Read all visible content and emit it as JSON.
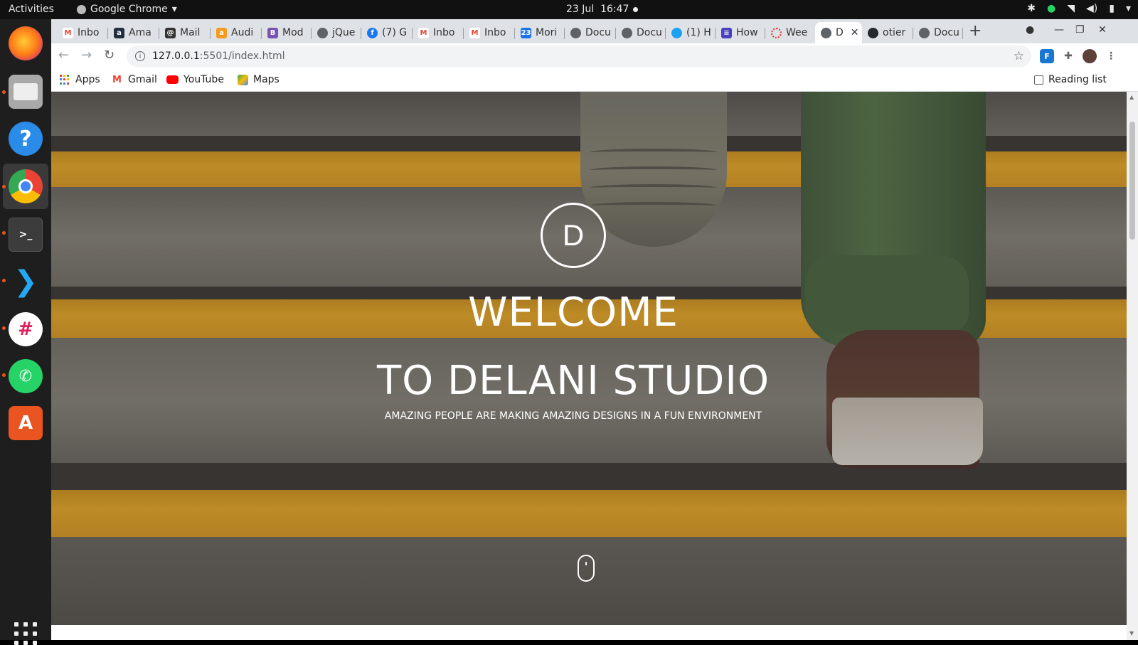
{
  "system_bar": {
    "activities": "Activities",
    "app_name": "Google Chrome",
    "date": "23 Jul",
    "time": "16:47"
  },
  "dock": {
    "apps": [
      "firefox-icon",
      "files-icon",
      "help-icon",
      "chrome-icon",
      "terminal-icon",
      "vscode-icon",
      "slack-icon",
      "whatsapp-icon",
      "software-center-icon"
    ]
  },
  "tabs": [
    {
      "label": "Inbo",
      "icon": "gmail-icon"
    },
    {
      "label": "Ama",
      "icon": "amazon-icon"
    },
    {
      "label": "Mail",
      "icon": "mailchimp-icon"
    },
    {
      "label": "Audi",
      "icon": "audible-icon"
    },
    {
      "label": "Mod",
      "icon": "bootstrap-icon"
    },
    {
      "label": "jQue",
      "icon": "globe-icon"
    },
    {
      "label": "(7) G",
      "icon": "facebook-icon"
    },
    {
      "label": "Inbo",
      "icon": "gmail-icon"
    },
    {
      "label": "Inbo",
      "icon": "gmail-icon"
    },
    {
      "label": "Mori",
      "icon": "calendar-icon"
    },
    {
      "label": "Docu",
      "icon": "globe-icon"
    },
    {
      "label": "Docu",
      "icon": "globe-icon"
    },
    {
      "label": "(1) H",
      "icon": "twitter-icon"
    },
    {
      "label": "How",
      "icon": "docs-icon"
    },
    {
      "label": "Wee",
      "icon": "loading-icon"
    },
    {
      "label": "D",
      "icon": "globe-icon",
      "active": true
    },
    {
      "label": "otier",
      "icon": "github-icon"
    },
    {
      "label": "Docu",
      "icon": "globe-icon"
    }
  ],
  "address_bar": {
    "host": "127.0.0.1",
    "path": ":5501/index.html"
  },
  "bookmarks": {
    "apps": "Apps",
    "gmail": "Gmail",
    "youtube": "YouTube",
    "maps": "Maps",
    "reading_list": "Reading list"
  },
  "hero": {
    "logo_letter": "D",
    "welcome": "WELCOME",
    "studio": "TO DELANI STUDIO",
    "tagline": "AMAZING PEOPLE ARE MAKING AMAZING DESIGNS IN A FUN ENVIRONMENT"
  },
  "colors": {
    "stripe_yellow": "#efae26",
    "concrete": "#6d6a62",
    "chrome_tabstrip": "#dee1e6",
    "ubuntu_accent": "#e95420"
  }
}
